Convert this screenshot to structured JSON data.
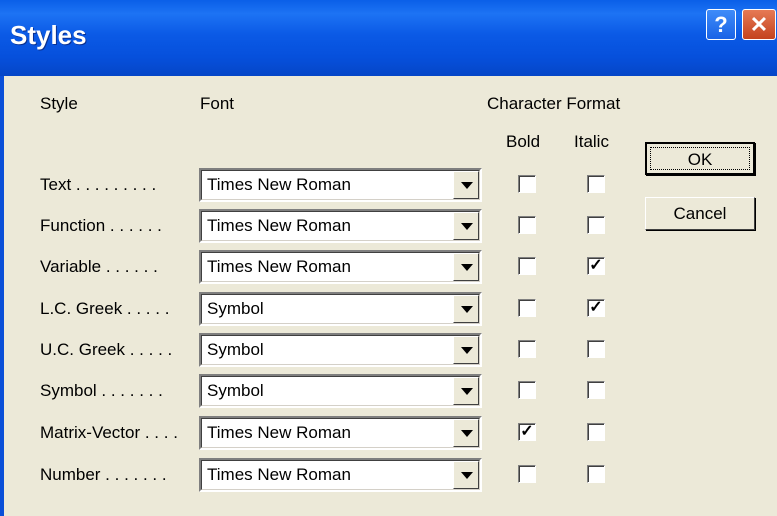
{
  "window": {
    "title": "Styles",
    "help_label": "?",
    "close_label": "✕"
  },
  "headers": {
    "style": "Style",
    "font": "Font",
    "char_format": "Character Format",
    "bold": "Bold",
    "italic": "Italic"
  },
  "buttons": {
    "ok": "OK",
    "cancel": "Cancel"
  },
  "rows": [
    {
      "label": "Text . . . . . . . . .",
      "font": "Times New Roman",
      "bold": false,
      "italic": false
    },
    {
      "label": "Function . . . . . .",
      "font": "Times New Roman",
      "bold": false,
      "italic": false
    },
    {
      "label": "Variable . . . . . .",
      "font": "Times New Roman",
      "bold": false,
      "italic": true
    },
    {
      "label": "L.C. Greek . . . . .",
      "font": "Symbol",
      "bold": false,
      "italic": true
    },
    {
      "label": "U.C. Greek . . . . .",
      "font": "Symbol",
      "bold": false,
      "italic": false
    },
    {
      "label": "Symbol . . . . . . .",
      "font": "Symbol",
      "bold": false,
      "italic": false
    },
    {
      "label": "Matrix-Vector . . . .",
      "font": "Times New Roman",
      "bold": true,
      "italic": false
    },
    {
      "label": "Number . . . . . . .",
      "font": "Times New Roman",
      "bold": false,
      "italic": false
    }
  ],
  "check_glyph": "✓"
}
